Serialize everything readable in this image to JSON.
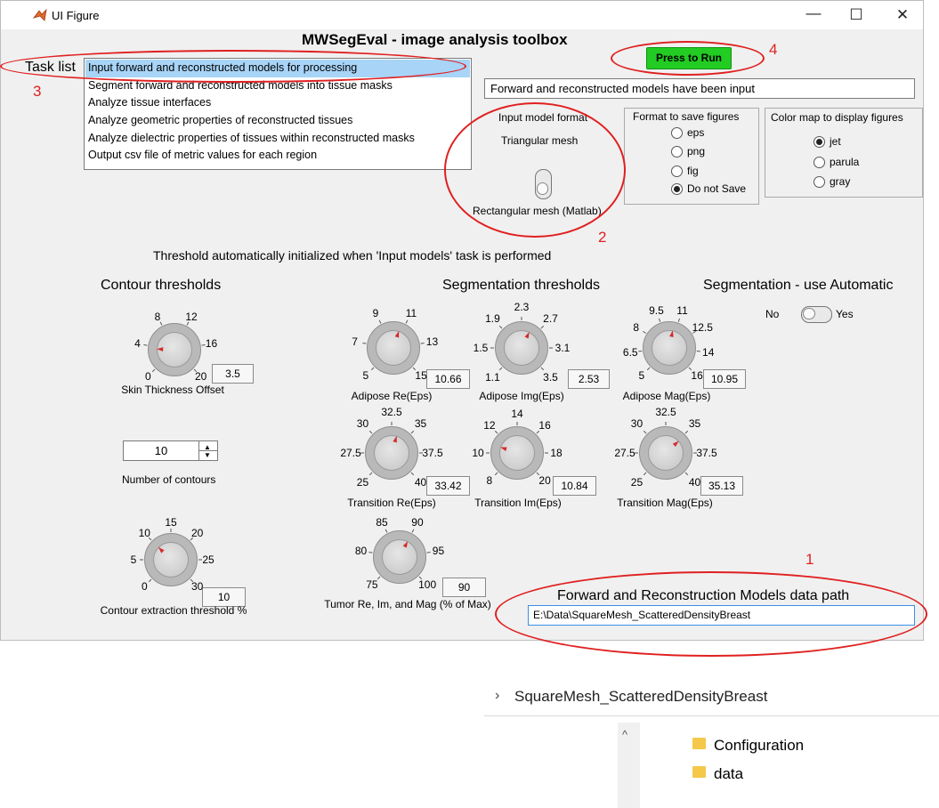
{
  "window": {
    "title": "UI Figure",
    "app_title": "MWSegEval - image analysis toolbox"
  },
  "tasks": {
    "label": "Task list",
    "items": [
      "Input forward and reconstructed models for processing",
      "Segment forward and reconstructed models into tissue masks",
      "Analyze tissue interfaces",
      "Analyze geometric properties of reconstructed tissues",
      "Analyze dielectric properties of tissues within reconstructed masks",
      "Output csv file of metric values for each region"
    ],
    "selected_index": 0
  },
  "run": {
    "label": "Press to Run",
    "color": "#22cc22",
    "status": "Forward and reconstructed models have been input"
  },
  "input_format": {
    "title": "Input model format",
    "option_top": "Triangular mesh",
    "option_bottom": "Rectangular mesh (Matlab)"
  },
  "save_format": {
    "title": "Format to save figures",
    "options": [
      "eps",
      "png",
      "fig",
      "Do not Save"
    ],
    "selected": "Do not Save"
  },
  "colormap": {
    "title": "Color map to display figures",
    "options": [
      "jet",
      "parula",
      "gray"
    ],
    "selected": "jet"
  },
  "threshold_note": "Threshold automatically initialized when 'Input models' task is performed",
  "contour": {
    "title": "Contour thresholds",
    "skin": {
      "label": "Skin Thickness Offset",
      "value": "3.5",
      "ticks": [
        "0",
        "4",
        "8",
        "12",
        "16",
        "20"
      ]
    },
    "num_contours": {
      "label": "Number of contours",
      "value": "10"
    },
    "extraction": {
      "label": "Contour extraction threshold %",
      "value": "10",
      "ticks": [
        "0",
        "5",
        "10",
        "15",
        "20",
        "25",
        "30"
      ]
    }
  },
  "segmentation": {
    "title": "Segmentation thresholds",
    "adipose_re": {
      "label": "Adipose Re(Eps)",
      "value": "10.66",
      "ticks": [
        "5",
        "7",
        "9",
        "11",
        "13",
        "15"
      ]
    },
    "adipose_img": {
      "label": "Adipose Img(Eps)",
      "value": "2.53",
      "ticks": [
        "1.1",
        "1.5",
        "1.9",
        "2.3",
        "2.7",
        "3.1",
        "3.5"
      ]
    },
    "adipose_mag": {
      "label": "Adipose Mag(Eps)",
      "value": "10.95",
      "ticks": [
        "5",
        "6.5",
        "8",
        "9.5",
        "11",
        "12.5",
        "14",
        "16"
      ]
    },
    "transition_re": {
      "label": "Transition Re(Eps)",
      "value": "33.42",
      "ticks": [
        "25",
        "27.5",
        "30",
        "32.5",
        "35",
        "37.5",
        "40"
      ]
    },
    "transition_im": {
      "label": "Transition Im(Eps)",
      "value": "10.84",
      "ticks": [
        "8",
        "10",
        "12",
        "14",
        "16",
        "18",
        "20"
      ]
    },
    "transition_mag": {
      "label": "Transition Mag(Eps)",
      "value": "35.13",
      "ticks": [
        "25",
        "27.5",
        "30",
        "32.5",
        "35",
        "37.5",
        "40"
      ]
    },
    "tumor": {
      "label": "Tumor Re, Im, and Mag (% of Max)",
      "value": "90",
      "ticks": [
        "75",
        "80",
        "85",
        "90",
        "95",
        "100"
      ]
    }
  },
  "automatic": {
    "title": "Segmentation - use Automatic",
    "no": "No",
    "yes": "Yes"
  },
  "data_path": {
    "title": "Forward and Reconstruction Models data path",
    "value": "E:\\Data\\SquareMesh_ScatteredDensityBreast"
  },
  "annotations": [
    "1",
    "2",
    "3",
    "4"
  ],
  "explorer": {
    "breadcrumb": "SquareMesh_ScatteredDensityBreast",
    "folders": [
      "Configuration",
      "data"
    ]
  }
}
